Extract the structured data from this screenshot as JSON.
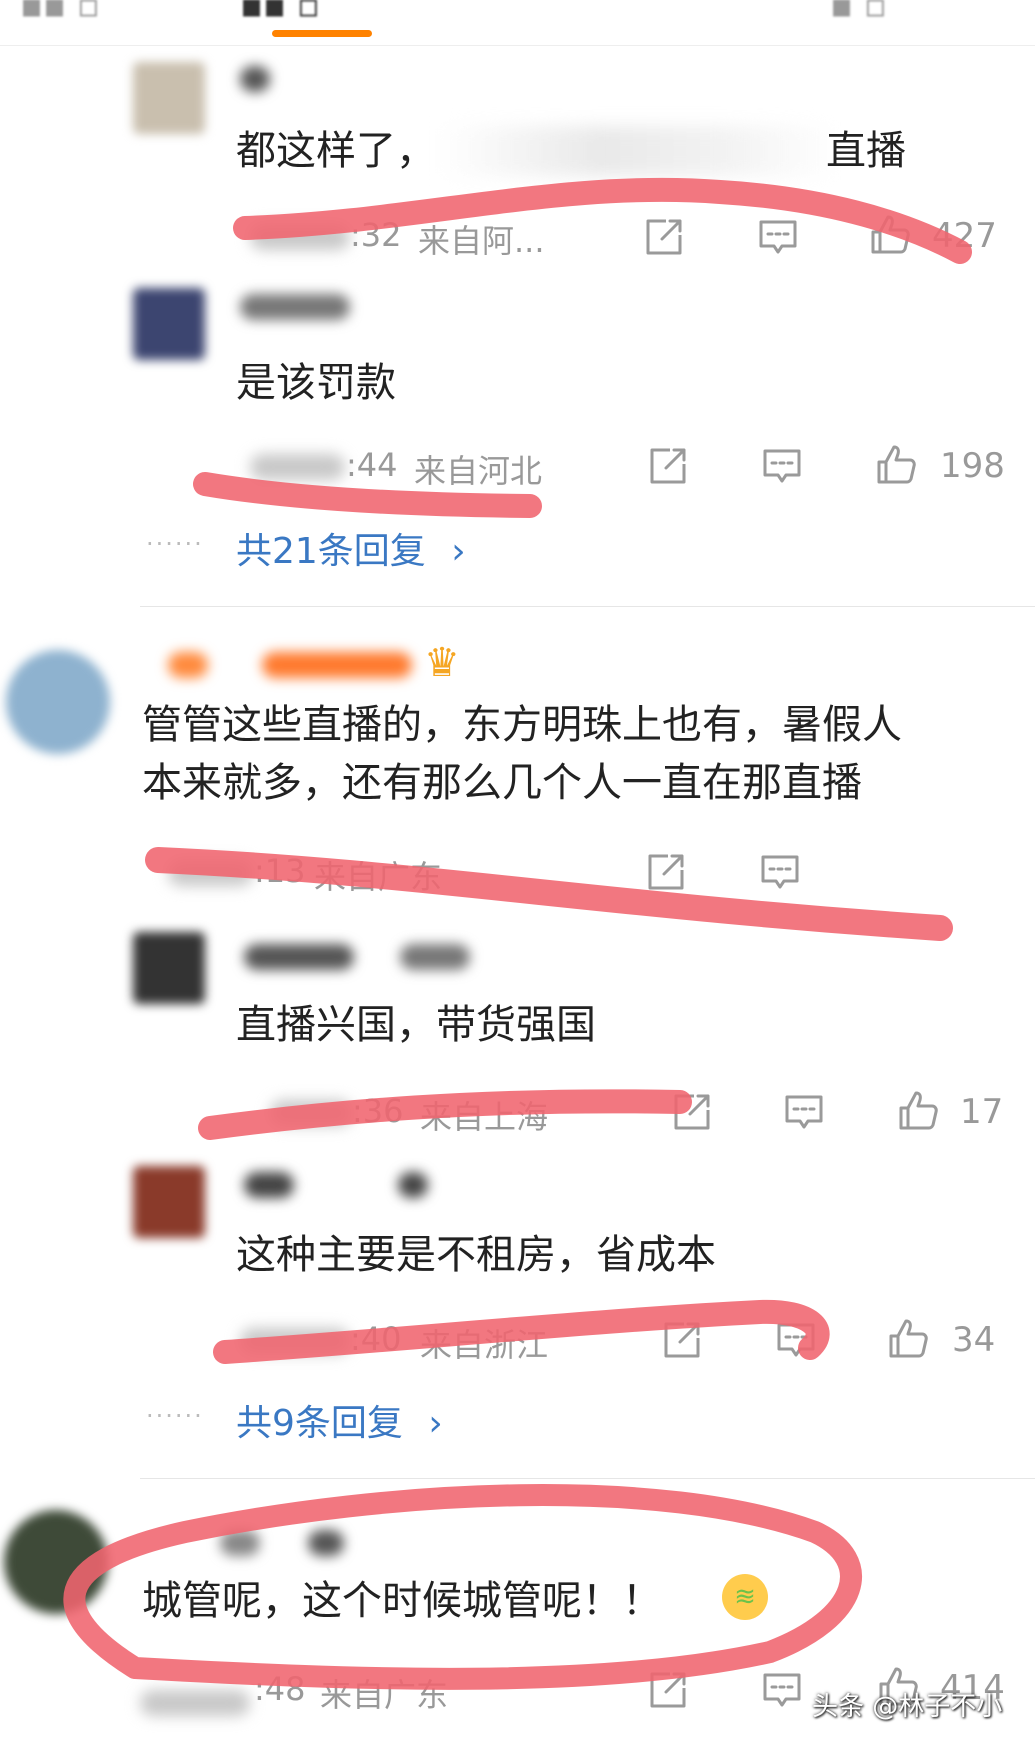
{
  "comments": [
    {
      "text_pre": "都这样了，",
      "text_post": "直播",
      "time": ":32",
      "location": "来自阿...",
      "likes": "427"
    },
    {
      "text": "是该罚款",
      "time": ":44",
      "location": "来自河北",
      "likes": "198",
      "replies": "共21条回复"
    },
    {
      "text_line1": "管管这些直播的，东方明珠上也有，暑假人",
      "text_line2": "本来就多，还有那么几个人一直在那直播",
      "time": ":13",
      "location": "来自广东"
    },
    {
      "text": "直播兴国，带货强国",
      "time": ":36",
      "location": "来自上海",
      "likes": "17"
    },
    {
      "text": "这种主要是不租房，省成本",
      "time": ":40",
      "location": "来自浙江",
      "likes": "34",
      "replies": "共9条回复"
    },
    {
      "text": "城管呢，这个时候城管呢！！",
      "time": ":48",
      "location": "来自广东",
      "likes": "414"
    }
  ],
  "reply_chevron": "›",
  "watermark": "头条 @林子不小",
  "colors": {
    "accent": "#ff8200",
    "link": "#3a78c3",
    "scribble": "#f0646e",
    "meta": "#999999"
  },
  "icons": [
    "share-icon",
    "comment-icon",
    "thumbs-up-icon",
    "crown-badge-icon",
    "vomit-emoji-icon"
  ]
}
